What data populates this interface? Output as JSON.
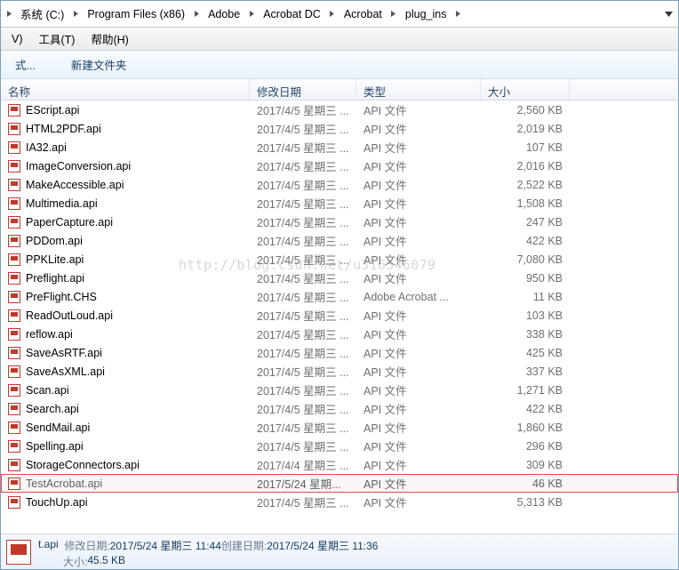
{
  "breadcrumb": {
    "segments": [
      "系统 (C:)",
      "Program Files (x86)",
      "Adobe",
      "Acrobat DC",
      "Acrobat",
      "plug_ins"
    ]
  },
  "menu": {
    "view": "V)",
    "tools": "工具(T)",
    "help": "帮助(H)"
  },
  "toolbar": {
    "organize": "式...",
    "new_folder": "新建文件夹"
  },
  "columns": {
    "name": "名称",
    "modified": "修改日期",
    "type": "类型",
    "size": "大小"
  },
  "files": [
    {
      "name": "EScript.api",
      "modified": "2017/4/5 星期三 ...",
      "type": "API 文件",
      "size": "2,560 KB",
      "selected": false
    },
    {
      "name": "HTML2PDF.api",
      "modified": "2017/4/5 星期三 ...",
      "type": "API 文件",
      "size": "2,019 KB",
      "selected": false
    },
    {
      "name": "IA32.api",
      "modified": "2017/4/5 星期三 ...",
      "type": "API 文件",
      "size": "107 KB",
      "selected": false
    },
    {
      "name": "ImageConversion.api",
      "modified": "2017/4/5 星期三 ...",
      "type": "API 文件",
      "size": "2,016 KB",
      "selected": false
    },
    {
      "name": "MakeAccessible.api",
      "modified": "2017/4/5 星期三 ...",
      "type": "API 文件",
      "size": "2,522 KB",
      "selected": false
    },
    {
      "name": "Multimedia.api",
      "modified": "2017/4/5 星期三 ...",
      "type": "API 文件",
      "size": "1,508 KB",
      "selected": false
    },
    {
      "name": "PaperCapture.api",
      "modified": "2017/4/5 星期三 ...",
      "type": "API 文件",
      "size": "247 KB",
      "selected": false
    },
    {
      "name": "PDDom.api",
      "modified": "2017/4/5 星期三 ...",
      "type": "API 文件",
      "size": "422 KB",
      "selected": false
    },
    {
      "name": "PPKLite.api",
      "modified": "2017/4/5 星期三 ...",
      "type": "API 文件",
      "size": "7,080 KB",
      "selected": false
    },
    {
      "name": "Preflight.api",
      "modified": "2017/4/5 星期三 ...",
      "type": "API 文件",
      "size": "950 KB",
      "selected": false
    },
    {
      "name": "PreFlight.CHS",
      "modified": "2017/4/5 星期三 ...",
      "type": "Adobe Acrobat ...",
      "size": "11 KB",
      "selected": false
    },
    {
      "name": "ReadOutLoud.api",
      "modified": "2017/4/5 星期三 ...",
      "type": "API 文件",
      "size": "103 KB",
      "selected": false
    },
    {
      "name": "reflow.api",
      "modified": "2017/4/5 星期三 ...",
      "type": "API 文件",
      "size": "338 KB",
      "selected": false
    },
    {
      "name": "SaveAsRTF.api",
      "modified": "2017/4/5 星期三 ...",
      "type": "API 文件",
      "size": "425 KB",
      "selected": false
    },
    {
      "name": "SaveAsXML.api",
      "modified": "2017/4/5 星期三 ...",
      "type": "API 文件",
      "size": "337 KB",
      "selected": false
    },
    {
      "name": "Scan.api",
      "modified": "2017/4/5 星期三 ...",
      "type": "API 文件",
      "size": "1,271 KB",
      "selected": false
    },
    {
      "name": "Search.api",
      "modified": "2017/4/5 星期三 ...",
      "type": "API 文件",
      "size": "422 KB",
      "selected": false
    },
    {
      "name": "SendMail.api",
      "modified": "2017/4/5 星期三 ...",
      "type": "API 文件",
      "size": "1,860 KB",
      "selected": false
    },
    {
      "name": "Spelling.api",
      "modified": "2017/4/5 星期三 ...",
      "type": "API 文件",
      "size": "296 KB",
      "selected": false
    },
    {
      "name": "StorageConnectors.api",
      "modified": "2017/4/4 星期三 ...",
      "type": "API 文件",
      "size": "309 KB",
      "selected": false
    },
    {
      "name": "TestAcrobat.api",
      "modified": "2017/5/24 星期...",
      "type": "API 文件",
      "size": "46 KB",
      "selected": true
    },
    {
      "name": "TouchUp.api",
      "modified": "2017/4/5 星期三 ...",
      "type": "API 文件",
      "size": "5,313 KB",
      "selected": false
    }
  ],
  "watermark": "http://blog.csdn.net/u316546079",
  "status": {
    "filename": "t.api",
    "modified_label": "修改日期: ",
    "modified_value": "2017/5/24 星期三 11:44",
    "created_label": " 创建日期: ",
    "created_value": "2017/5/24 星期三 11:36",
    "size_label": "大小: ",
    "size_value": "45.5 KB"
  }
}
